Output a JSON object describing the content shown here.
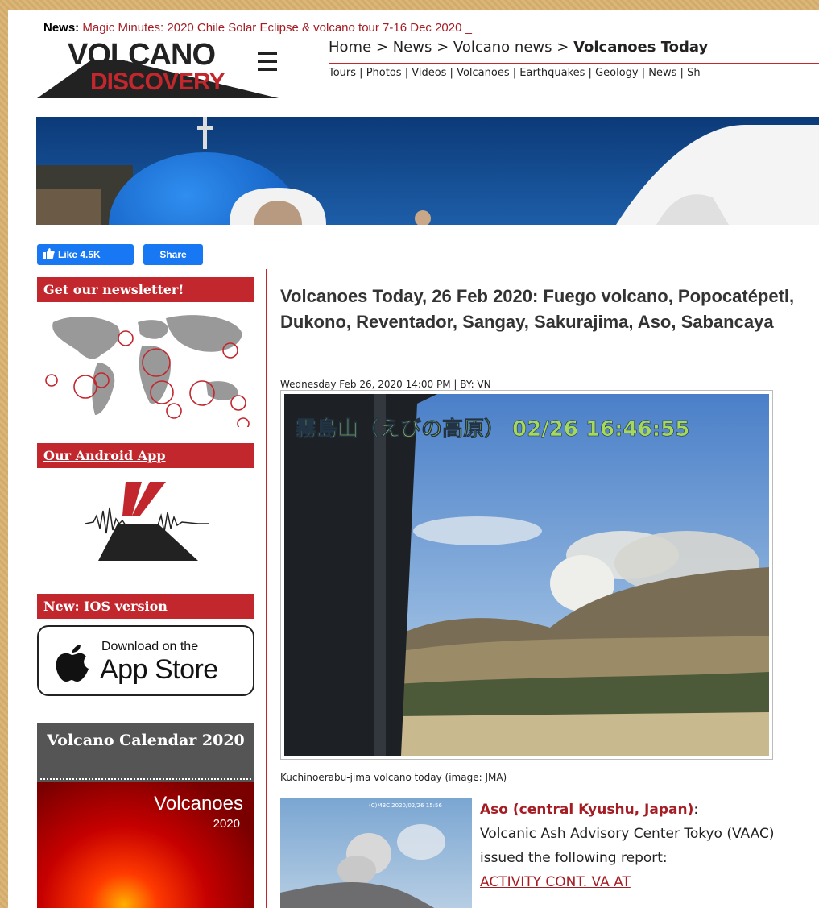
{
  "header": {
    "news_label": "News:",
    "news_text": "Magic Minutes: 2020 Chile Solar Eclipse & volcano tour 7-16 Dec 2020 _",
    "logo_line1": "VOLCANO",
    "logo_line2": "DISCOVERY",
    "breadcrumb": [
      "Home",
      ">",
      "News",
      ">",
      "Volcano news",
      ">",
      "Volcanoes Today"
    ],
    "topnav": [
      "Tours",
      "Photos",
      "Videos",
      "Volcanoes",
      "Earthquakes",
      "Geology",
      "News",
      "Sh"
    ]
  },
  "social": {
    "like_label": "Like 4.5K",
    "share_label": "Share"
  },
  "sidebar": {
    "newsletter": "Get our newsletter!",
    "android": "Our Android App",
    "ios": "New: IOS version",
    "appstore_line1": "Download on the",
    "appstore_line2": "App Store",
    "calendar_title": "Volcano Calendar 2020",
    "calendar_cover_title": "Volcanoes",
    "calendar_cover_year": "2020"
  },
  "article": {
    "title": "Volcanoes Today, 26 Feb 2020: Fuego volcano, Popocatépetl, Dukono, Reventador, Sangay, Sakurajima, Aso, Sabancaya",
    "byline": "Wednesday Feb 26, 2020 14:00 PM | BY: VN",
    "image_stamp": "霧島山（えびの高原） 02/26 16:46:55",
    "caption": "Kuchinoerabu-jima volcano today (image: JMA)",
    "thumb_stamp": "(C)MBC 2020/02/26 15:56",
    "aso_link": "Aso (central Kyushu, Japan)",
    "aso_colon": ":",
    "aso_text": "Volcanic Ash Advisory Center Tokyo (VAAC) issued the following report:",
    "aso_report_link": "ACTIVITY CONT. VA AT"
  },
  "colors": {
    "brand_red": "#c1272d",
    "facebook_blue": "#1877f2",
    "page_bg": "#d9b270"
  }
}
